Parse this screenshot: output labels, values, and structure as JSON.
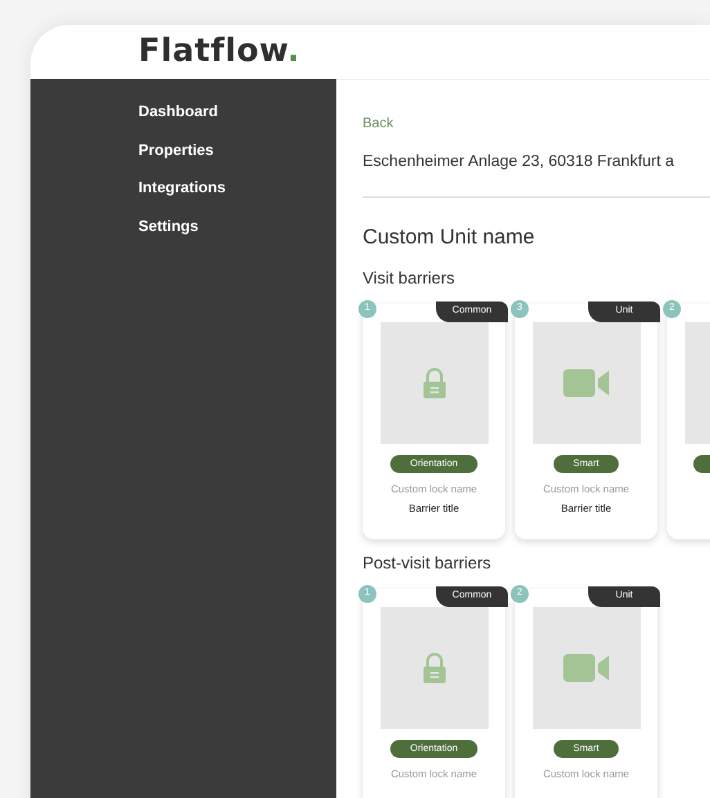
{
  "logo": {
    "text": "Flatflow",
    "dot": "."
  },
  "sidebar": {
    "items": [
      {
        "label": "Dashboard"
      },
      {
        "label": "Properties"
      },
      {
        "label": "Integrations"
      },
      {
        "label": "Settings"
      }
    ]
  },
  "back_link": "Back",
  "address": "Eschenheimer Anlage 23, 60318 Frankfurt a",
  "unit_name": "Custom Unit name",
  "sections": [
    {
      "title": "Visit barriers",
      "cards": [
        {
          "number": "1",
          "scope": "Common",
          "kind": "lock",
          "tag": "Orientation",
          "lock_name": "Custom lock name",
          "title": "Barrier title"
        },
        {
          "number": "3",
          "scope": "Unit",
          "kind": "camera",
          "tag": "Smart",
          "lock_name": "Custom lock name",
          "title": "Barrier title"
        },
        {
          "number": "2",
          "kind": "blank"
        }
      ]
    },
    {
      "title": "Post-visit barriers",
      "cards": [
        {
          "number": "1",
          "scope": "Common",
          "kind": "lock",
          "tag": "Orientation",
          "lock_name": "Custom lock name"
        },
        {
          "number": "2",
          "scope": "Unit",
          "kind": "camera",
          "tag": "Smart",
          "lock_name": "Custom lock name"
        }
      ]
    }
  ]
}
